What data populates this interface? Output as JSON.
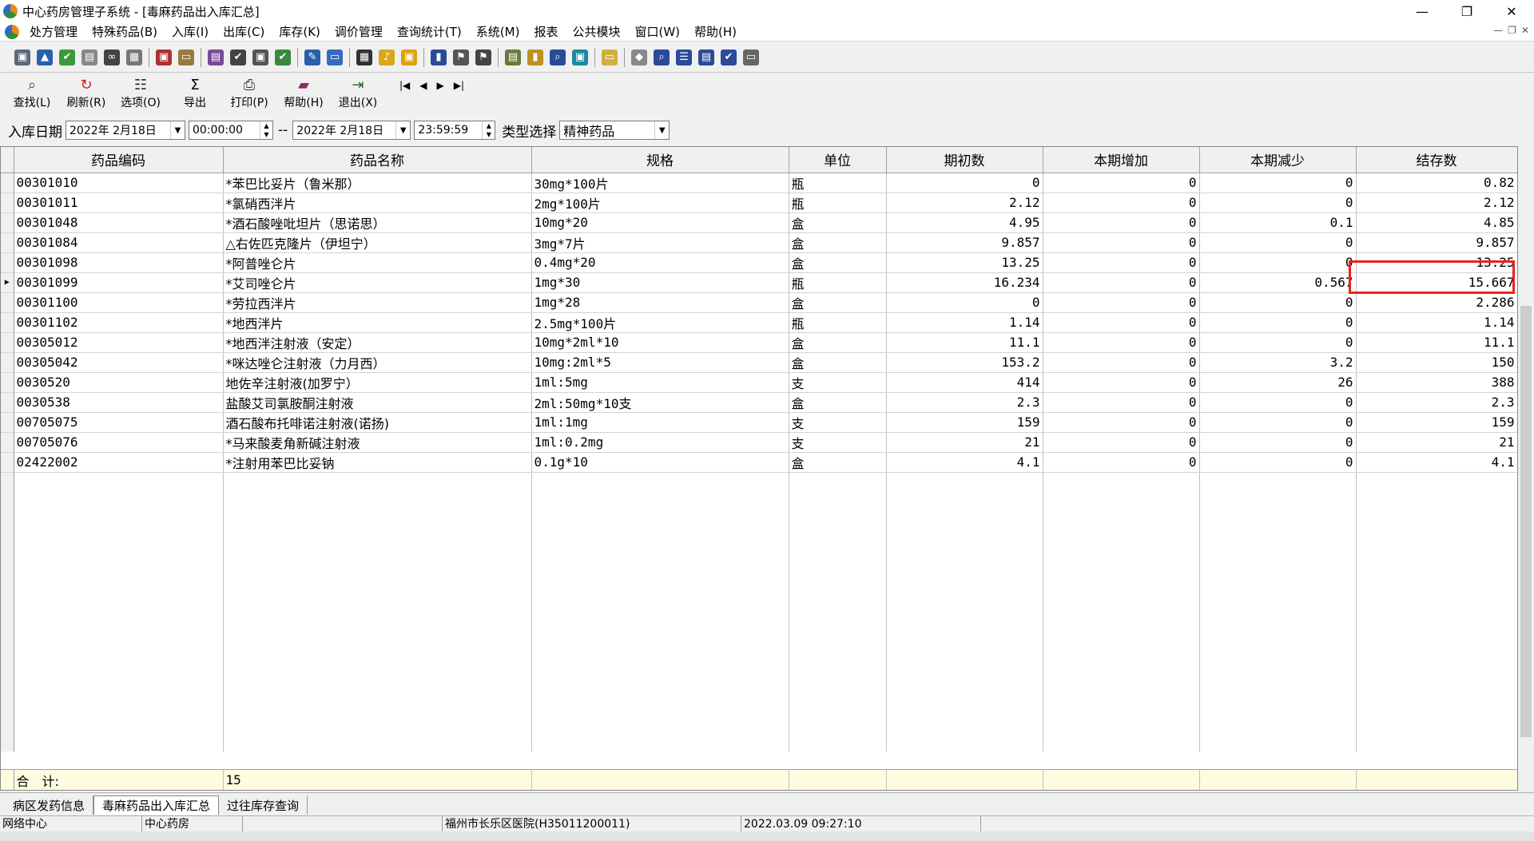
{
  "window": {
    "title": "中心药房管理子系统 - [毒麻药品出入库汇总]",
    "minimize": "—",
    "maximize": "❐",
    "close": "✕"
  },
  "menu": [
    "处方管理",
    "特殊药品(B)",
    "入库(I)",
    "出库(C)",
    "库存(K)",
    "调价管理",
    "查询统计(T)",
    "系统(M)",
    "报表",
    "公共模块",
    "窗口(W)",
    "帮助(H)"
  ],
  "commands": [
    {
      "label": "查找(L)",
      "icon": "search-icon"
    },
    {
      "label": "刷新(R)",
      "icon": "refresh-icon"
    },
    {
      "label": "选项(O)",
      "icon": "options-icon"
    },
    {
      "label": "导出",
      "icon": "sigma-icon"
    },
    {
      "label": "打印(P)",
      "icon": "printer-icon"
    },
    {
      "label": "帮助(H)",
      "icon": "help-book-icon"
    },
    {
      "label": "退出(X)",
      "icon": "exit-icon"
    }
  ],
  "filter": {
    "date_label": "入库日期",
    "start_date": "2022年 2月18日",
    "start_time": "00:00:00",
    "separator": "--",
    "end_date": "2022年 2月18日",
    "end_time": "23:59:59",
    "type_label": "类型选择",
    "type_value": "精神药品"
  },
  "table": {
    "columns": [
      "药品编码",
      "药品名称",
      "规格",
      "单位",
      "期初数",
      "本期增加",
      "本期减少",
      "结存数"
    ],
    "rows": [
      [
        "00301010",
        "*苯巴比妥片（鲁米那）",
        "30mg*100片",
        "瓶",
        "0",
        "0",
        "0",
        "0.82"
      ],
      [
        "00301011",
        "*氯硝西泮片",
        "2mg*100片",
        "瓶",
        "2.12",
        "0",
        "0",
        "2.12"
      ],
      [
        "00301048",
        "*酒石酸唑吡坦片（思诺思）",
        "10mg*20",
        "盒",
        "4.95",
        "0",
        "0.1",
        "4.85"
      ],
      [
        "00301084",
        "△右佐匹克隆片（伊坦宁）",
        "3mg*7片",
        "盒",
        "9.857",
        "0",
        "0",
        "9.857"
      ],
      [
        "00301098",
        "*阿普唑仑片",
        "0.4mg*20",
        "盒",
        "13.25",
        "0",
        "0",
        "13.25"
      ],
      [
        "00301099",
        "*艾司唑仑片",
        "1mg*30",
        "瓶",
        "16.234",
        "0",
        "0.567",
        "15.667"
      ],
      [
        "00301100",
        "*劳拉西泮片",
        "1mg*28",
        "盒",
        "0",
        "0",
        "0",
        "2.286"
      ],
      [
        "00301102",
        "*地西泮片",
        "2.5mg*100片",
        "瓶",
        "1.14",
        "0",
        "0",
        "1.14"
      ],
      [
        "00305012",
        "*地西泮注射液（安定）",
        "10mg*2ml*10",
        "盒",
        "11.1",
        "0",
        "0",
        "11.1"
      ],
      [
        "00305042",
        "*咪达唑仑注射液（力月西）",
        "10mg:2ml*5",
        "盒",
        "153.2",
        "0",
        "3.2",
        "150"
      ],
      [
        "0030520",
        "地佐辛注射液(加罗宁）",
        "1ml:5mg",
        "支",
        "414",
        "0",
        "26",
        "388"
      ],
      [
        "0030538",
        "盐酸艾司氯胺酮注射液",
        "2ml:50mg*10支",
        "盒",
        "2.3",
        "0",
        "0",
        "2.3"
      ],
      [
        "00705075",
        "酒石酸布托啡诺注射液(诺扬)",
        "1ml:1mg",
        "支",
        "159",
        "0",
        "0",
        "159"
      ],
      [
        "00705076",
        "*马来酸麦角新碱注射液",
        "1ml:0.2mg",
        "支",
        "21",
        "0",
        "0",
        "21"
      ],
      [
        "02422002",
        "*注射用苯巴比妥钠",
        "0.1g*10",
        "盒",
        "4.1",
        "0",
        "0",
        "4.1"
      ]
    ],
    "current_row": 5,
    "total_label": "合　计:",
    "total_count": "15"
  },
  "tabs": [
    "病区发药信息",
    "毒麻药品出入库汇总",
    "过往库存查询"
  ],
  "active_tab": 1,
  "status": [
    "网络中心",
    "中心药房",
    "",
    "福州市长乐区医院(H35011200011)",
    "2022.03.09 09:27:10"
  ]
}
